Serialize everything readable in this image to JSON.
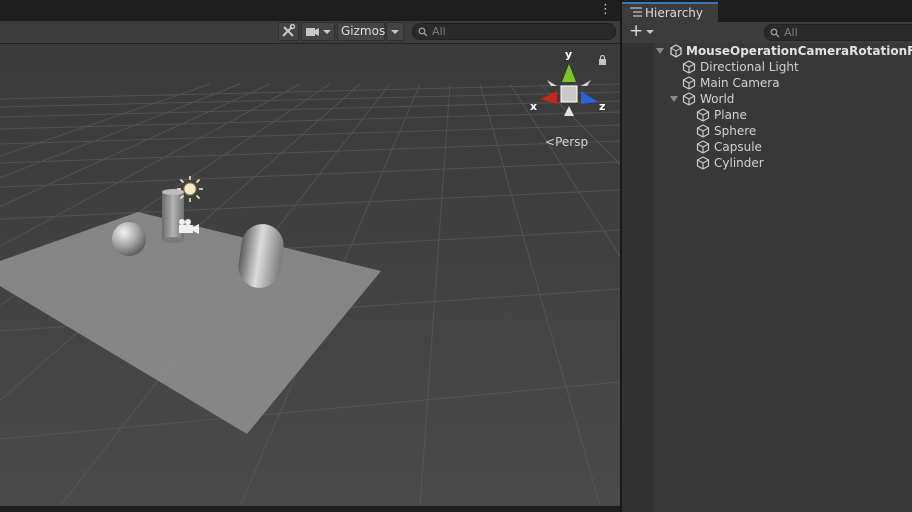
{
  "scene": {
    "gizmos_label": "Gizmos",
    "search_placeholder": "All",
    "projection_label": "Persp",
    "axis_x": "x",
    "axis_y": "y",
    "axis_z": "z",
    "colors": {
      "axis_x": "#c3271d",
      "axis_y": "#7dc32b",
      "axis_z": "#2a64d8",
      "plane": "#8d8d8d",
      "background": "#474747"
    }
  },
  "hierarchy": {
    "tab_label": "Hierarchy",
    "search_placeholder": "All",
    "scene_name": "MouseOperationCameraRotationFovMo",
    "items": [
      {
        "label": "Directional Light",
        "icon": "cube-icon"
      },
      {
        "label": "Main Camera",
        "icon": "cube-icon"
      },
      {
        "label": "World",
        "icon": "cube-icon"
      },
      {
        "label": "Plane",
        "icon": "cube-icon"
      },
      {
        "label": "Sphere",
        "icon": "cube-icon"
      },
      {
        "label": "Capsule",
        "icon": "cube-icon"
      },
      {
        "label": "Cylinder",
        "icon": "cube-icon"
      }
    ]
  }
}
